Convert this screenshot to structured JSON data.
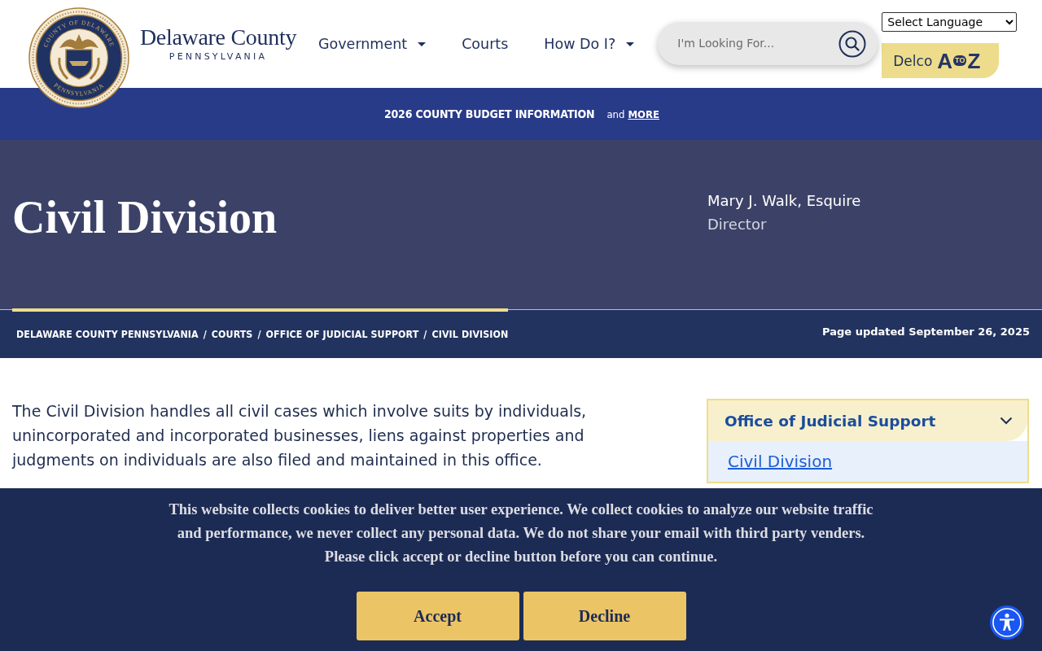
{
  "header": {
    "seal": {
      "top_text": "COUNTY OF DELAWARE",
      "bottom_text": "PENNSYLVANIA"
    },
    "logo": {
      "title": "Delaware County",
      "subtitle": "PENNSYLVANIA"
    },
    "nav": [
      {
        "label": "Government",
        "dropdown": true
      },
      {
        "label": "Courts",
        "dropdown": false
      },
      {
        "label": "How Do I?",
        "dropdown": true
      }
    ],
    "search": {
      "placeholder": "I'm Looking For..."
    },
    "language_select": {
      "value": "Select Language"
    },
    "az_button": {
      "label": "Delco",
      "logo_start": "A",
      "logo_middle": "TO",
      "logo_end": "Z"
    }
  },
  "announcement": {
    "title": "2026 COUNTY BUDGET INFORMATION",
    "connector": "and",
    "link": "MORE"
  },
  "hero": {
    "title": "Civil Division",
    "contact_name": "Mary J. Walk, Esquire",
    "contact_role": "Director"
  },
  "breadcrumb": {
    "items": [
      {
        "label": "DELAWARE COUNTY PENNSYLVANIA",
        "separator": "/"
      },
      {
        "label": "COURTS",
        "separator": "/"
      },
      {
        "label": "OFFICE OF JUDICIAL SUPPORT",
        "separator": "/"
      },
      {
        "label": "CIVIL DIVISION"
      }
    ],
    "updated": "Page updated September 26, 2025"
  },
  "content": {
    "paragraph": "The Civil Division handles all civil cases which involve suits by individuals, unincorporated and incorporated businesses, liens against properties and judgments on individuals are also filed and maintained in this office."
  },
  "sidebar": {
    "title": "Office of Judicial Support",
    "expanded": true,
    "items": [
      {
        "label": "Civil Division",
        "selected": true
      }
    ]
  },
  "cookie_banner": {
    "message_lines": [
      "This website collects cookies to deliver better user experience. We collect cookies to analyze our website traffic",
      "and performance, we never collect any personal data. We do not share your email with third party venders.",
      "Please click accept or decline button before you can continue."
    ],
    "buttons": [
      {
        "label": "Accept"
      },
      {
        "label": "Decline"
      }
    ]
  }
}
